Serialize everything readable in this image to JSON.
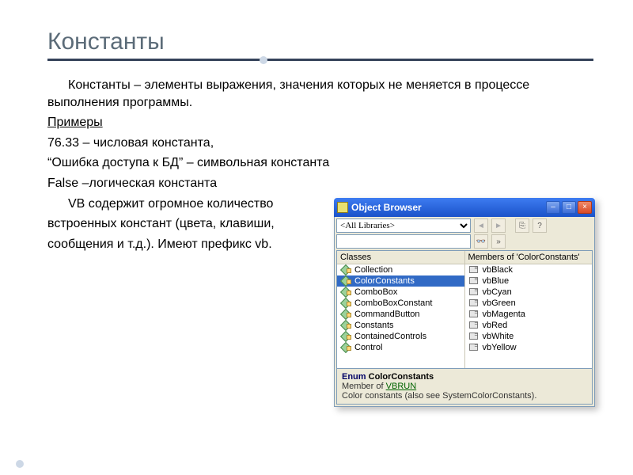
{
  "title": "Константы",
  "para": {
    "def": "Константы – элементы выражения, значения которых не меняется в процессе выполнения программы.",
    "examples": "Примеры",
    "line1": "76.33 – числовая константа,",
    "line2": "“Ошибка доступа к БД” – символьная константа",
    "line3": "False –логическая константа",
    "line4": "VB содержит огромное количество",
    "line5": "встроенных констант (цвета, клавиши,",
    "line6": "сообщения и т.д.). Имеют префикс vb."
  },
  "ob": {
    "title": "Object Browser",
    "library_value": "<All Libraries>",
    "search_value": "",
    "toolbar_icons": {
      "back": "◄",
      "fwd": "►",
      "copy": "⎘",
      "help": "?",
      "find": "⌕",
      "binoc": "👓",
      "show": "»"
    },
    "classes_header": "Classes",
    "members_header": "Members of 'ColorConstants'",
    "classes": [
      "Collection",
      "ColorConstants",
      "ComboBox",
      "ComboBoxConstant",
      "CommandButton",
      "Constants",
      "ContainedControls",
      "Control"
    ],
    "classes_selected_index": 1,
    "members": [
      "vbBlack",
      "vbBlue",
      "vbCyan",
      "vbGreen",
      "vbMagenta",
      "vbRed",
      "vbWhite",
      "vbYellow"
    ],
    "bottom_sig_kw": "Enum",
    "bottom_sig_name": "ColorConstants",
    "bottom_member_of": "Member of",
    "bottom_link": "VBRUN",
    "bottom_desc": "Color constants (also see SystemColorConstants)."
  },
  "footer": {
    "left": "",
    "right": ""
  }
}
